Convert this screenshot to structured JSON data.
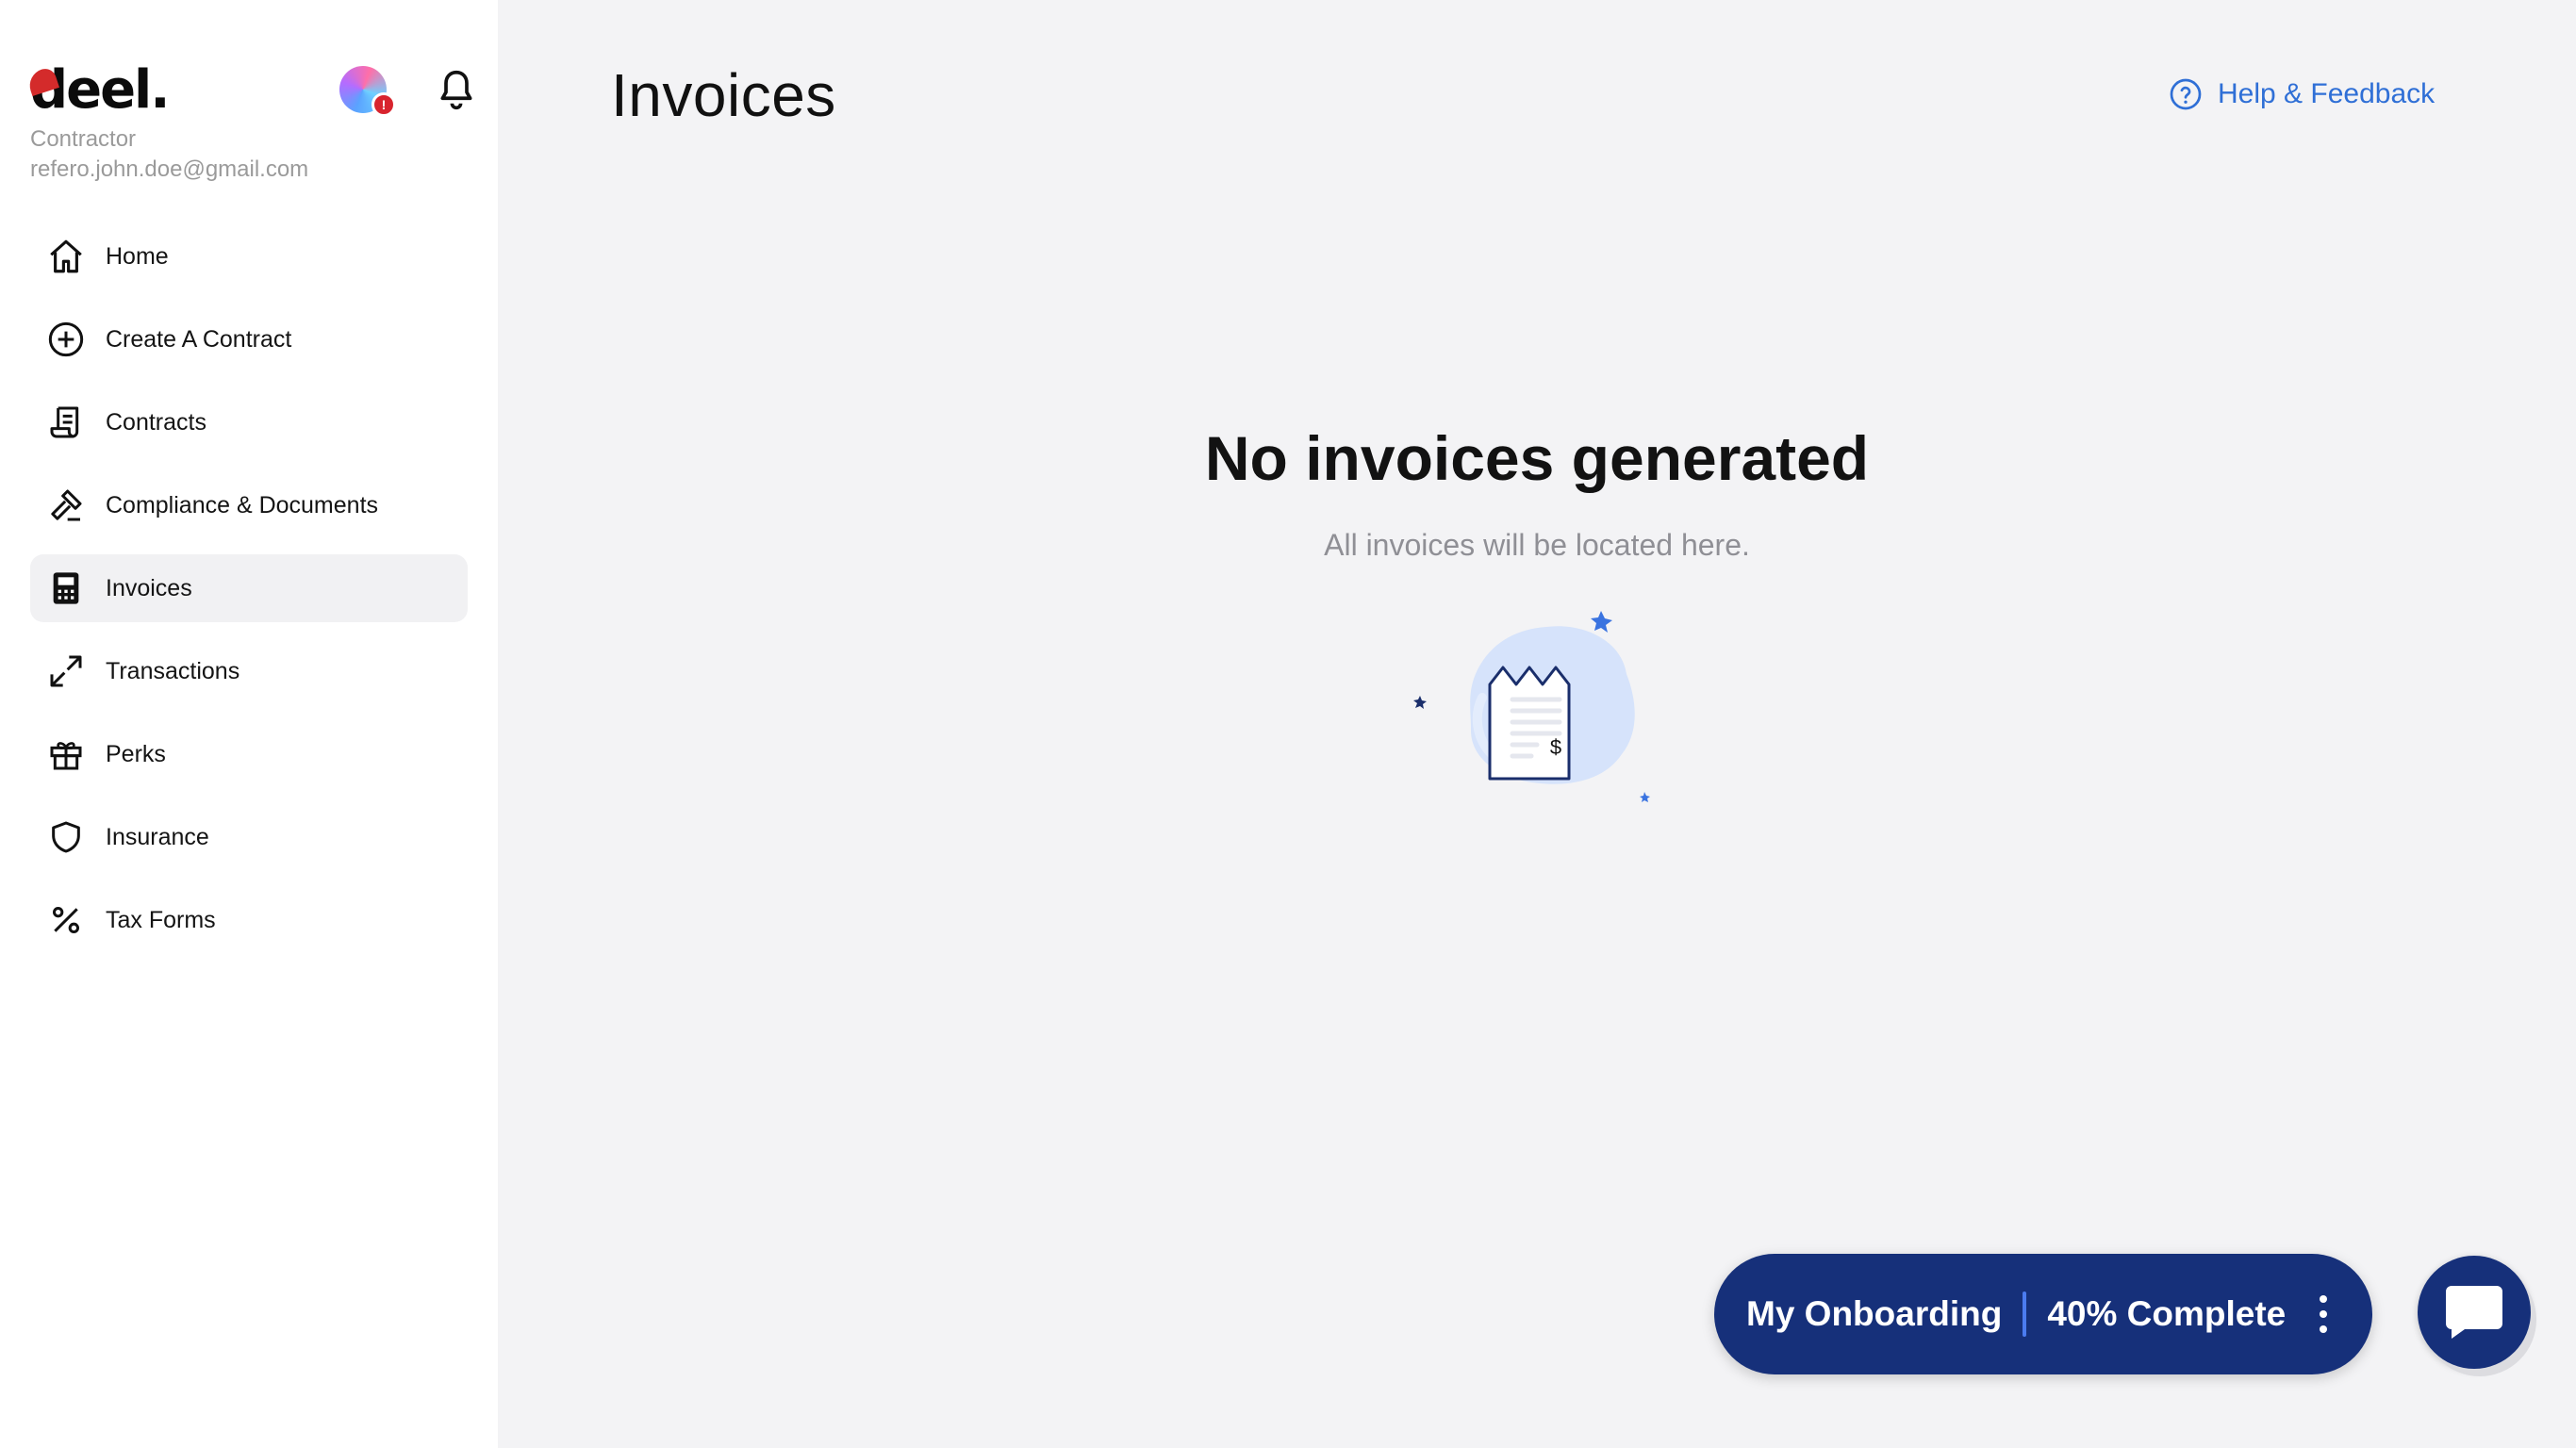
{
  "brand": {
    "logo_text": "deel.",
    "role": "Contractor",
    "email": "refero.john.doe@gmail.com",
    "avatar_badge": "!"
  },
  "nav": {
    "items": [
      {
        "label": "Home",
        "icon": "home-icon"
      },
      {
        "label": "Create A Contract",
        "icon": "plus-circle-icon"
      },
      {
        "label": "Contracts",
        "icon": "scroll-icon"
      },
      {
        "label": "Compliance & Documents",
        "icon": "gavel-icon"
      },
      {
        "label": "Invoices",
        "icon": "calculator-icon",
        "active": true
      },
      {
        "label": "Transactions",
        "icon": "arrows-diagonal-icon"
      },
      {
        "label": "Perks",
        "icon": "gift-icon"
      },
      {
        "label": "Insurance",
        "icon": "shield-icon"
      },
      {
        "label": "Tax Forms",
        "icon": "percent-icon"
      }
    ]
  },
  "header": {
    "title": "Invoices",
    "help_label": "Help & Feedback"
  },
  "empty_state": {
    "title": "No invoices generated",
    "subtitle": "All invoices will be located here.",
    "receipt_symbol": "$"
  },
  "onboarding": {
    "label": "My Onboarding",
    "progress_text": "40% Complete",
    "progress_fraction": 0.4
  },
  "colors": {
    "accent": "#2f6fd6",
    "navy": "#16307a",
    "logo_red": "#d42b2b",
    "background": "#f3f3f5"
  }
}
